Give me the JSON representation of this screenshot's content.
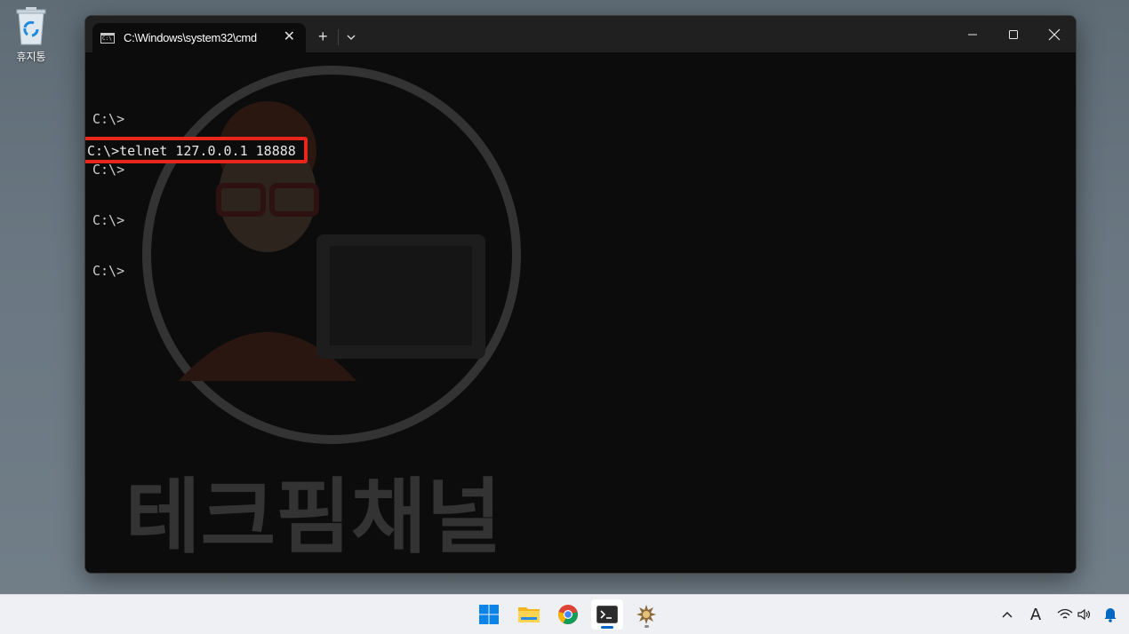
{
  "desktop": {
    "icons": [
      {
        "label": "휴지통",
        "icon": "recycle-bin-icon"
      }
    ]
  },
  "window": {
    "tab_title": "C:\\Windows\\system32\\cmd",
    "tab_icon": "console-icon",
    "tab_icon_text": "C:\\",
    "close_tab_glyph": "✕",
    "new_tab_glyph": "+",
    "controls": [
      "minimize",
      "maximize",
      "close"
    ]
  },
  "console": {
    "lines": [
      "C:\\>",
      "C:\\>",
      "C:\\>",
      "C:\\>"
    ],
    "highlighted_command": "C:\\>telnet 127.0.0.1 18888",
    "highlight_color": "#e8261b",
    "text_color": "#cccccc",
    "background_color": "#0c0c0c",
    "watermark_text": "테크핌채널"
  },
  "taskbar": {
    "apps": [
      {
        "name": "start",
        "icon": "windows-logo-icon",
        "active": false
      },
      {
        "name": "file-explorer",
        "icon": "folder-icon",
        "active": false
      },
      {
        "name": "chrome",
        "icon": "chrome-icon",
        "active": false
      },
      {
        "name": "terminal",
        "icon": "terminal-icon",
        "active": true
      },
      {
        "name": "app",
        "icon": "gear-app-icon",
        "active": false
      }
    ],
    "tray": {
      "ime_indicator": "A",
      "icons": [
        "chevron-up-icon",
        "wifi-icon",
        "volume-icon",
        "notification-bell-icon"
      ]
    },
    "accent_color": "#0067c0"
  }
}
